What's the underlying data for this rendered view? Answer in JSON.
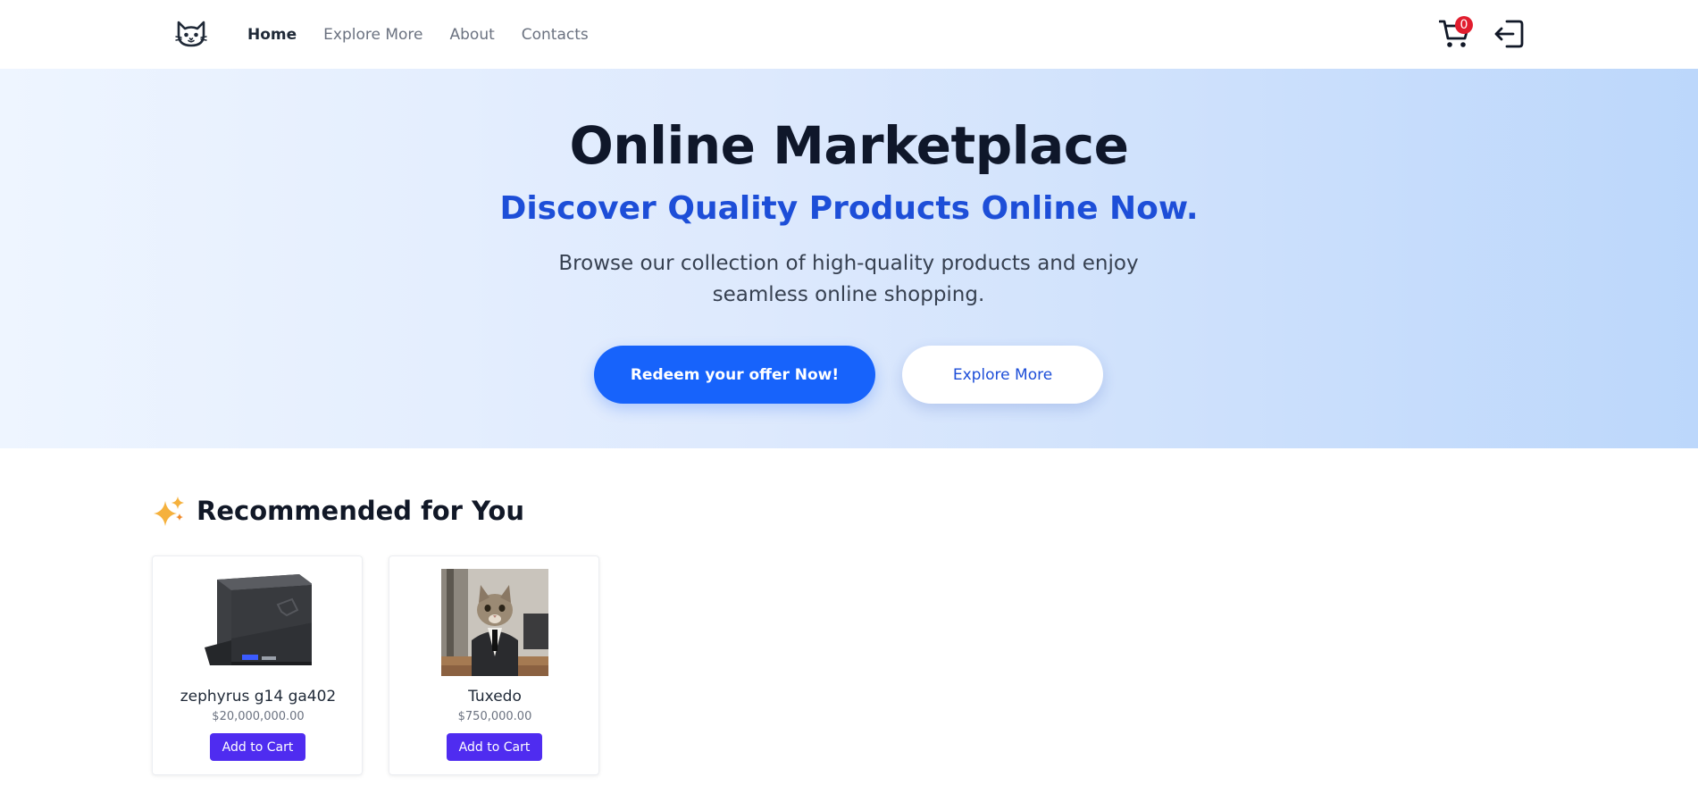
{
  "nav": {
    "logo_icon": "cat-face-icon",
    "links": [
      {
        "label": "Home",
        "active": true
      },
      {
        "label": "Explore More",
        "active": false
      },
      {
        "label": "About",
        "active": false
      },
      {
        "label": "Contacts",
        "active": false
      }
    ],
    "cart_icon": "shopping-cart-icon",
    "cart_count": "0",
    "logout_icon": "logout-icon"
  },
  "hero": {
    "title": "Online Marketplace",
    "subtitle": "Discover Quality Products Online Now.",
    "description": "Browse our collection of high-quality products and enjoy seamless online shopping.",
    "primary_button": "Redeem your offer Now!",
    "secondary_button": "Explore More"
  },
  "recommended": {
    "icon": "sparkles-icon",
    "title": "Recommended for You",
    "products": [
      {
        "name": "zephyrus g14 ga402",
        "price": "$20,000,000.00",
        "button": "Add to Cart",
        "image": "laptop-image"
      },
      {
        "name": "Tuxedo",
        "price": "$750,000.00",
        "button": "Add to Cart",
        "image": "cat-in-tuxedo-image"
      }
    ]
  },
  "colors": {
    "primary_blue": "#1763fb",
    "subtitle_blue": "#1d4ed8",
    "cart_button": "#4f2cf0",
    "badge_red": "#e11d2e"
  }
}
